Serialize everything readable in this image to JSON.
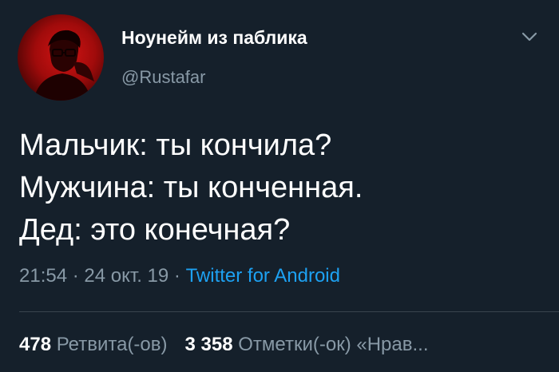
{
  "author": {
    "display_name": "Ноунейм из паблика",
    "handle": "@Rustafar",
    "avatar_icon": "profile-photo"
  },
  "tweet": {
    "lines": [
      "Мальчик: ты кончила?",
      "Мужчина: ты конченная.",
      "Дед: это конечная?"
    ],
    "time": "21:54",
    "separator": " · ",
    "date": "24 окт. 19",
    "source": "Twitter for Android"
  },
  "stats": {
    "retweets_count": "478",
    "retweets_label": "Ретвита(-ов)",
    "likes_count": "3 358",
    "likes_label": "Отметки(-ок) «Нрав..."
  },
  "colors": {
    "background": "#15202b",
    "text": "#ffffff",
    "muted": "#8899a6",
    "link": "#1da1f2",
    "divider": "#38444d"
  }
}
